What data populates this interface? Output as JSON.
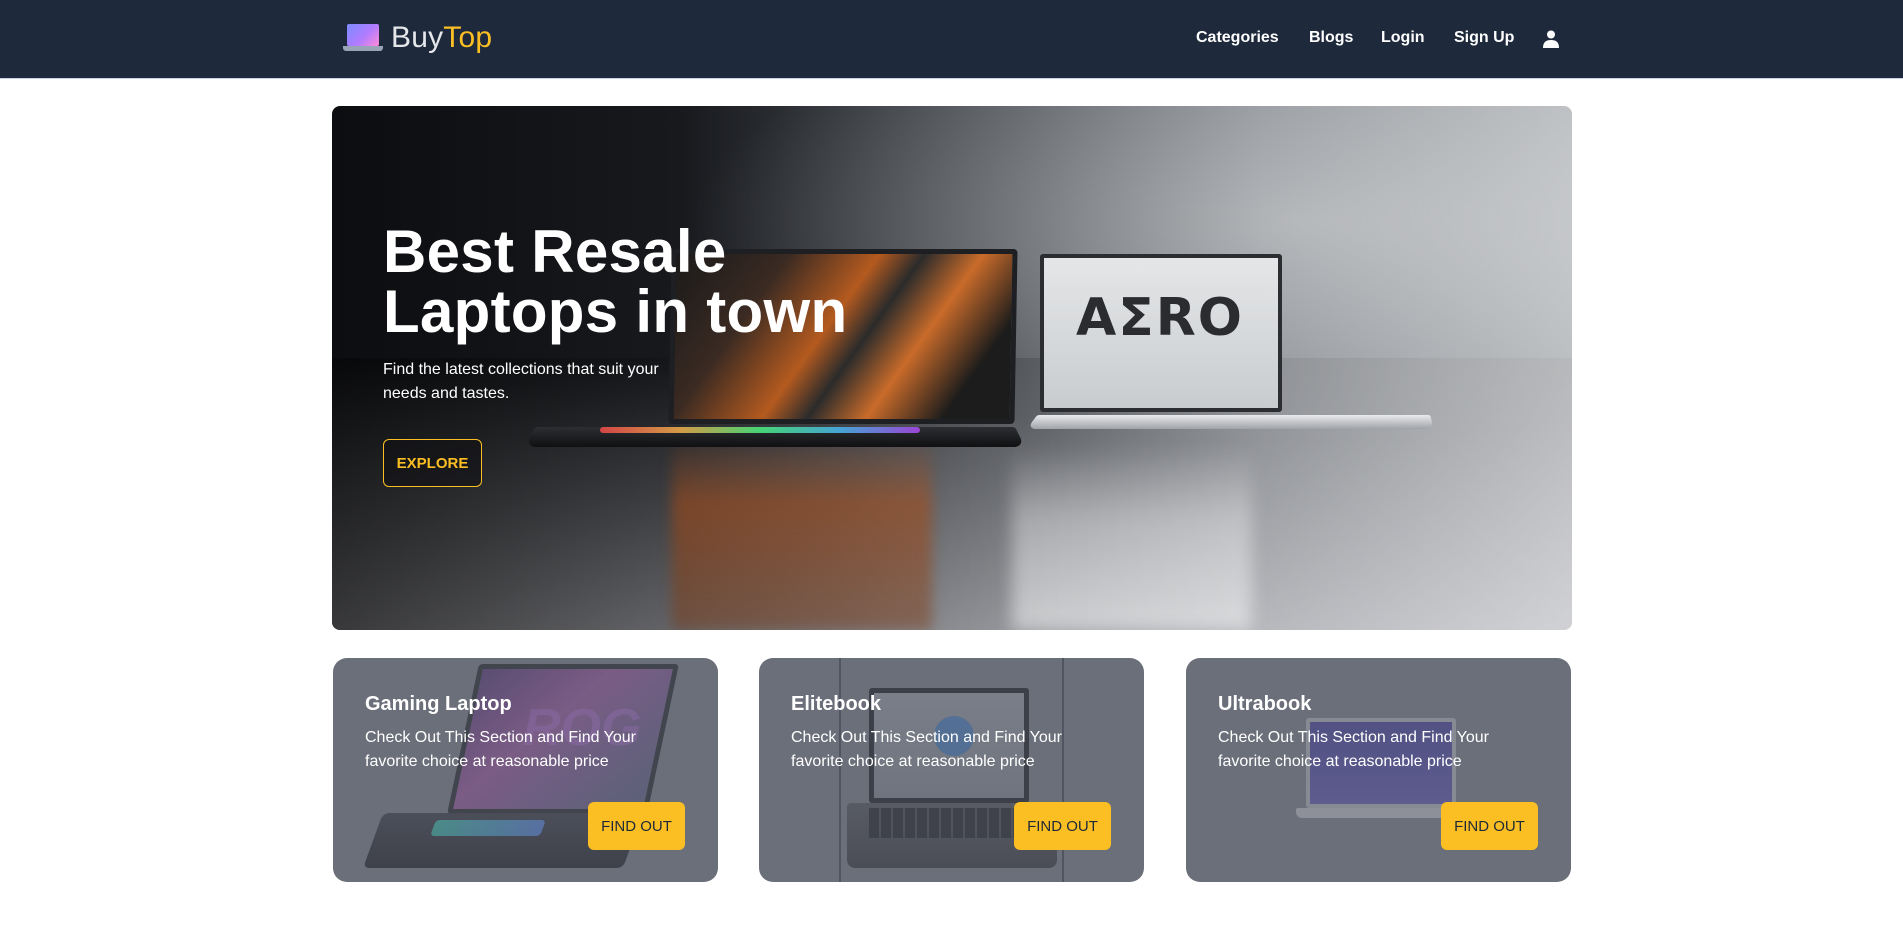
{
  "navbar": {
    "brand": {
      "part1": "Buy",
      "part2": "Top",
      "logo_icon": "laptop-icon"
    },
    "links": {
      "categories": "Categories",
      "blogs": "Blogs",
      "login": "Login",
      "signup": "Sign Up"
    },
    "profile_icon": "user-icon"
  },
  "hero": {
    "title_line1": "Best Resale",
    "title_line2": "Laptops in town",
    "subtitle": "Find the latest collections that suit your needs and tastes.",
    "cta_label": "EXPLORE",
    "laptop_screen_text": "AΣRO"
  },
  "cards": [
    {
      "title": "Gaming Laptop",
      "description": "Check Out This Section and Find Your favorite choice at reasonable price",
      "button_label": "FIND OUT"
    },
    {
      "title": "Elitebook",
      "description": "Check Out This Section and Find Your favorite choice at reasonable price",
      "button_label": "FIND OUT"
    },
    {
      "title": "Ultrabook",
      "description": "Check Out This Section and Find Your favorite choice at reasonable price",
      "button_label": "FIND OUT"
    }
  ],
  "colors": {
    "navbar_bg": "#1e293b",
    "accent": "#fbbf24",
    "card_bg": "#6b6f7a"
  }
}
